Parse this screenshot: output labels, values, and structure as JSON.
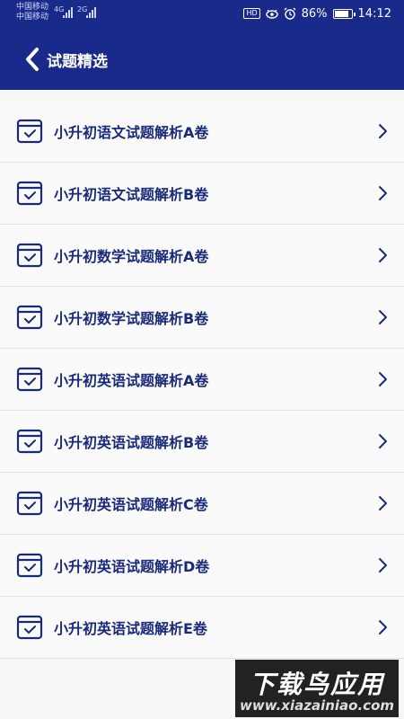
{
  "status_bar": {
    "carrier_1": "中国移动",
    "carrier_2": "中国移动",
    "net_1": "4G",
    "net_2": "2G",
    "hd_badge": "HD",
    "battery_percent": "86%",
    "time": "14:12"
  },
  "header": {
    "title": "试题精选"
  },
  "list": {
    "items": [
      {
        "label": "小升初语文试题解析A卷"
      },
      {
        "label": "小升初语文试题解析B卷"
      },
      {
        "label": "小升初数学试题解析A卷"
      },
      {
        "label": "小升初数学试题解析B卷"
      },
      {
        "label": "小升初英语试题解析A卷"
      },
      {
        "label": "小升初英语试题解析B卷"
      },
      {
        "label": "小升初英语试题解析C卷"
      },
      {
        "label": "小升初英语试题解析D卷"
      },
      {
        "label": "小升初英语试题解析E卷"
      }
    ]
  },
  "watermark": {
    "top_text": "下载鸟应用",
    "bottom_text": "www.xiazainiao.com"
  },
  "colors": {
    "header_bg": "#1a2a8a",
    "item_text": "#1a2a7a",
    "icon_stroke": "#1a2a7a"
  }
}
